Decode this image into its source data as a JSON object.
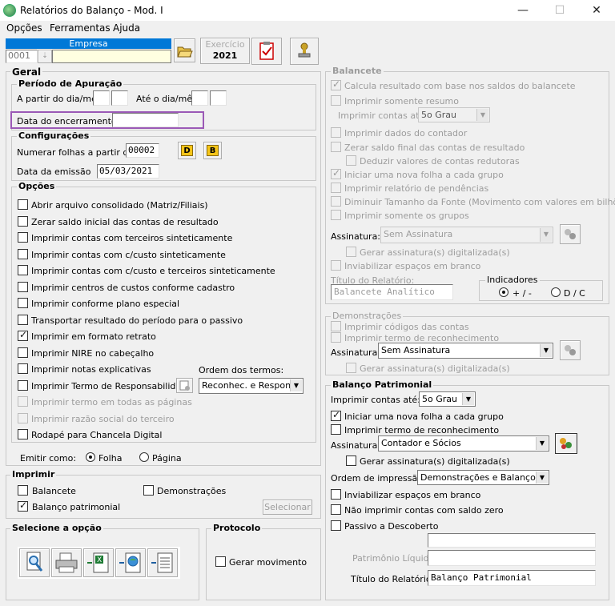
{
  "window": {
    "title": "Relatórios do Balanço - Mod. I",
    "minimize": "—",
    "maximize": "☐",
    "close": "✕"
  },
  "menu": [
    "Opções",
    "Ferramentas",
    "Ajuda"
  ],
  "empresa": {
    "label": "Empresa",
    "code": "0001",
    "name": ""
  },
  "exercicio": {
    "label": "Exercício",
    "year": "2021"
  },
  "geral": {
    "title": "Geral",
    "periodo": {
      "title": "Período de Apuração",
      "a_partir_label": "A partir do dia/mês",
      "ate_label": "Até o dia/mês",
      "encerramento_label": "Data do encerramento"
    },
    "config": {
      "title": "Configurações",
      "numerar_label": "Numerar folhas a partir de",
      "numerar_value": "00002",
      "btn_d": "D",
      "btn_b": "B",
      "emissao_label": "Data da emissão",
      "emissao_value": "05/03/2021"
    },
    "opcoes": {
      "title": "Opções",
      "items": [
        {
          "label": "Abrir arquivo consolidado (Matriz/Filiais)",
          "checked": false,
          "enabled": true
        },
        {
          "label": "Zerar saldo inicial das contas de resultado",
          "checked": false,
          "enabled": true
        },
        {
          "label": "Imprimir contas com terceiros sinteticamente",
          "checked": false,
          "enabled": true
        },
        {
          "label": "Imprimir contas com c/custo sinteticamente",
          "checked": false,
          "enabled": true
        },
        {
          "label": "Imprimir contas com c/custo e terceiros sinteticamente",
          "checked": false,
          "enabled": true
        },
        {
          "label": "Imprimir centros de custos conforme cadastro",
          "checked": false,
          "enabled": true
        },
        {
          "label": "Imprimir conforme plano especial",
          "checked": false,
          "enabled": true
        },
        {
          "label": "Transportar resultado do período para o passivo",
          "checked": false,
          "enabled": true
        },
        {
          "label": "Imprimir em formato retrato",
          "checked": true,
          "enabled": true
        },
        {
          "label": "Imprimir NIRE no cabeçalho",
          "checked": false,
          "enabled": true
        },
        {
          "label": "Imprimir notas explicativas",
          "checked": false,
          "enabled": true
        },
        {
          "label": "Imprimir Termo de Responsabilidade",
          "checked": false,
          "enabled": true
        },
        {
          "label": "Imprimir termo em todas as páginas",
          "checked": false,
          "enabled": false
        },
        {
          "label": "Imprimir razão social do terceiro",
          "checked": false,
          "enabled": false
        },
        {
          "label": "Rodapé para Chancela Digital",
          "checked": false,
          "enabled": true
        }
      ],
      "ordem_label": "Ordem dos termos:",
      "ordem_value": "Reconhec. e Respons."
    },
    "emitir": {
      "label": "Emitir como:",
      "folha": "Folha",
      "pagina": "Página",
      "selected": "Folha"
    }
  },
  "imprimir": {
    "title": "Imprimir",
    "balancete": "Balancete",
    "demonstracoes": "Demonstrações",
    "balanco": "Balanço patrimonial",
    "balanco_checked": true,
    "selecionar": "Selecionar"
  },
  "selecione": {
    "title": "Selecione a opção",
    "icons": [
      "preview-icon",
      "printer-icon",
      "excel-export-icon",
      "web-export-icon",
      "text-export-icon"
    ]
  },
  "protocolo": {
    "title": "Protocolo",
    "gerar": "Gerar movimento"
  },
  "balancete": {
    "title": "Balancete",
    "items1": [
      {
        "label": "Calcula resultado com base nos saldos do balancete",
        "checked": true
      },
      {
        "label": "Imprimir somente resumo",
        "checked": false
      }
    ],
    "contas_ate_label": "Imprimir contas até:",
    "contas_ate_value": "5o Grau",
    "items2": [
      {
        "label": "Imprimir dados do contador",
        "checked": false
      },
      {
        "label": "Zerar saldo final das contas de resultado",
        "checked": false
      },
      {
        "label": "Deduzir valores de contas redutoras",
        "checked": false
      },
      {
        "label": "Iniciar uma nova folha a cada grupo",
        "checked": true
      },
      {
        "label": "Imprimir relatório de pendências",
        "checked": false
      },
      {
        "label": "Diminuir Tamanho da Fonte (Movimento com valores em bilhões)",
        "checked": false
      },
      {
        "label": "Imprimir somente os grupos",
        "checked": false
      }
    ],
    "assinatura_label": "Assinatura:",
    "assinatura_value": "Sem Assinatura",
    "gerar_assinatura": "Gerar assinatura(s) digitalizada(s)",
    "inviabilizar": "Inviabilizar espaços em branco",
    "titulo_label": "Título do Relatório:",
    "titulo_value": "Balancete Analítico",
    "indicadores": {
      "title": "Indicadores",
      "opt1": "+ / -",
      "opt2": "D / C",
      "selected": "+ / -"
    }
  },
  "demonstracoes": {
    "title": "Demonstrações",
    "item1": "Imprimir códigos das contas",
    "item2": "Imprimir termo de reconhecimento",
    "assinatura_label": "Assinatura:",
    "assinatura_value": "Sem Assinatura",
    "gerar_assinatura": "Gerar assinatura(s) digitalizada(s)"
  },
  "balanco": {
    "title": "Balanço Patrimonial",
    "contas_ate_label": "Imprimir contas até:",
    "contas_ate_value": "5o Grau",
    "nova_folha": "Iniciar uma nova folha a cada grupo",
    "nova_folha_checked": true,
    "termo": "Imprimir termo de reconhecimento",
    "assinatura_label": "Assinatura:",
    "assinatura_value": "Contador e Sócios",
    "gerar_assinatura": "Gerar assinatura(s) digitalizada(s)",
    "ordem_label": "Ordem de impressão:",
    "ordem_value": "Demonstrações e Balanço",
    "inviabilizar": "Inviabilizar espaços em branco",
    "nao_imprimir": "Não imprimir contas com saldo zero",
    "passivo": "Passivo a Descoberto",
    "patrimonio_label": "Patrimônio Líquido",
    "titulo_label": "Título do Relatório:",
    "titulo_value": "Balanço Patrimonial"
  }
}
